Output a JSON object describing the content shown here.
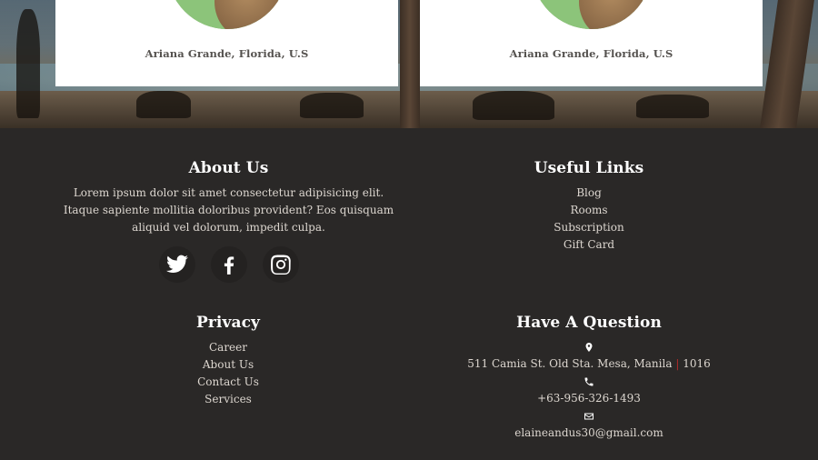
{
  "team_cards": [
    {
      "name": "Ariana Grande, Florida, U.S"
    },
    {
      "name": "Ariana Grande, Florida, U.S"
    }
  ],
  "footer": {
    "about": {
      "title": "About Us",
      "text": "Lorem ipsum dolor sit amet consectetur adipisicing elit. Itaque sapiente mollitia doloribus provident? Eos quisquam aliquid vel dolorum, impedit culpa.",
      "social": [
        "twitter-icon",
        "facebook-icon",
        "instagram-icon"
      ]
    },
    "useful_links": {
      "title": "Useful Links",
      "items": [
        "Blog",
        "Rooms",
        "Subscription",
        "Gift Card"
      ]
    },
    "privacy": {
      "title": "Privacy",
      "items": [
        "Career",
        "About Us",
        "Contact Us",
        "Services"
      ]
    },
    "question": {
      "title": "Have A Question",
      "address_main": "511 Camia St. Old Sta. Mesa, Manila",
      "address_sep": "|",
      "address_zip": "1016",
      "phone": "+63-956-326-1493",
      "email": "elaineandus30@gmail.com",
      "icons": [
        "map-marker-icon",
        "phone-icon",
        "envelope-icon"
      ]
    }
  },
  "colors": {
    "footer_bg": "#2a2827",
    "card_bg": "#ffffff",
    "separator_accent": "#b32a2a"
  }
}
